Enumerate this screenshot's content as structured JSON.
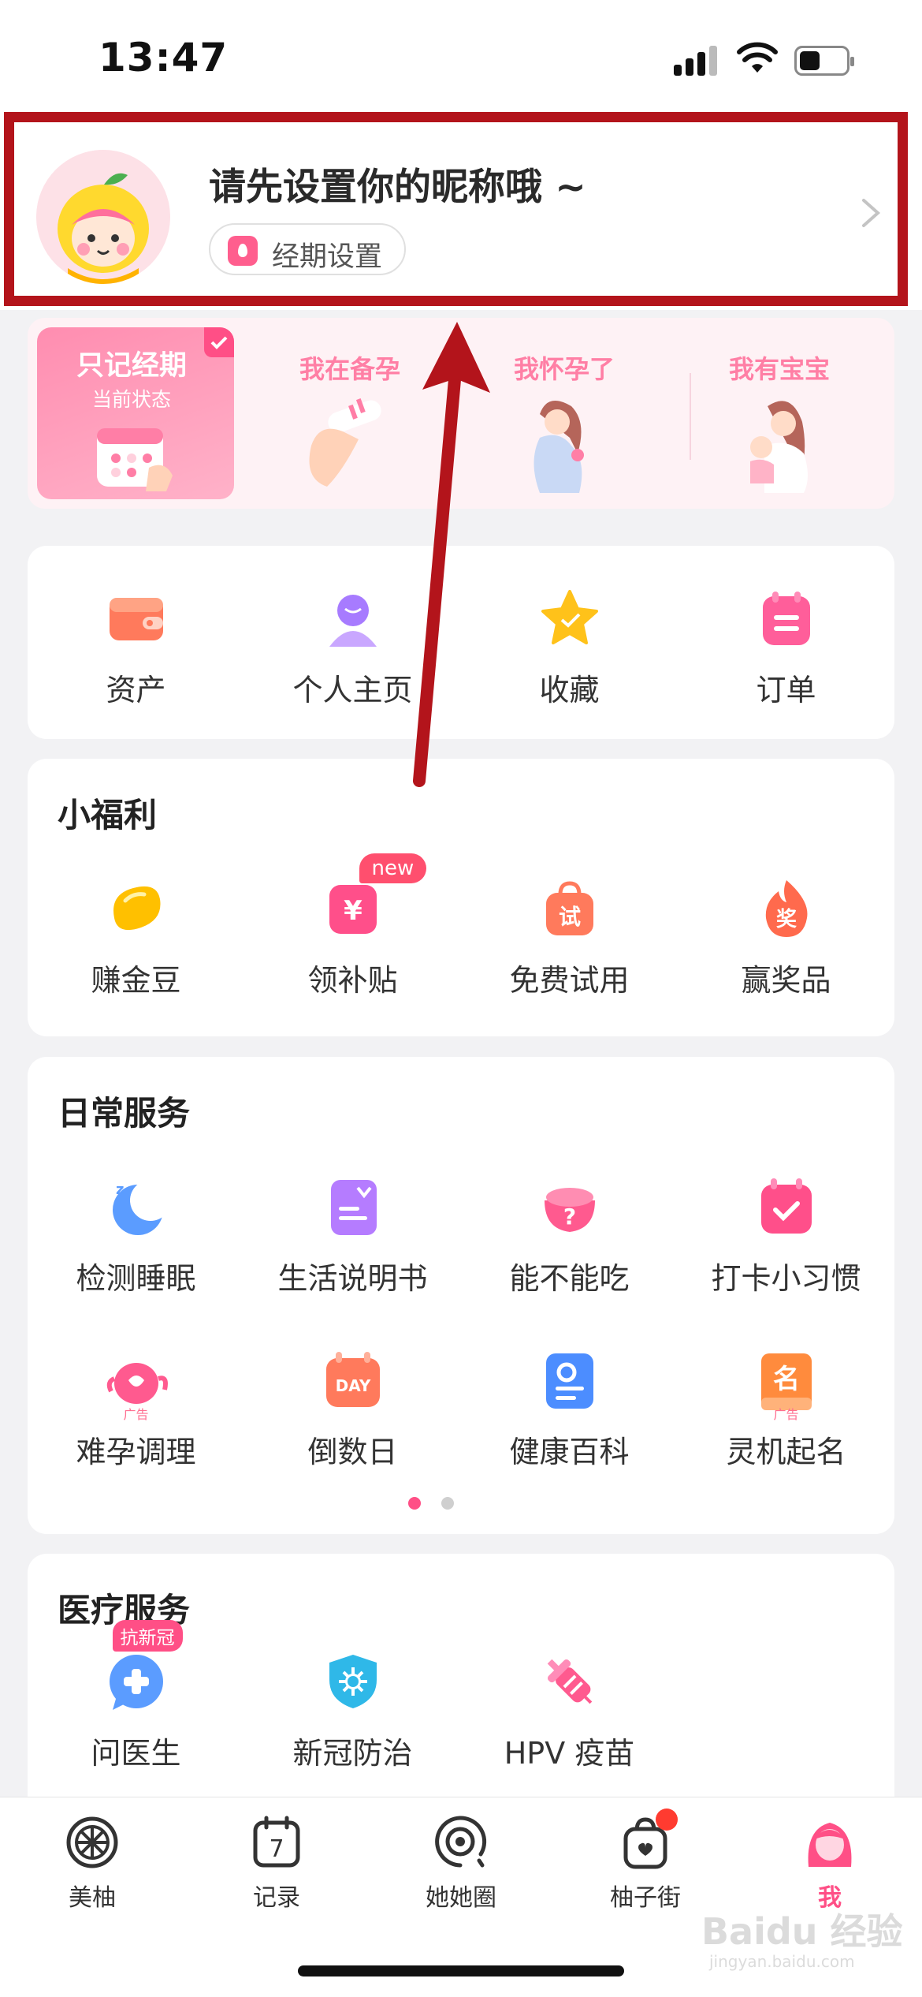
{
  "status": {
    "time": "13:47",
    "battery_level": 0.45
  },
  "profile": {
    "nickname": "请先设置你的昵称哦 ~",
    "period_label": "经期设置"
  },
  "states": {
    "active": {
      "title": "只记经期",
      "subtitle": "当前状态"
    },
    "items": [
      "我在备孕",
      "我怀孕了",
      "我有宝宝"
    ]
  },
  "quick": [
    {
      "label": "资产",
      "icon": "wallet-icon"
    },
    {
      "label": "个人主页",
      "icon": "person-icon"
    },
    {
      "label": "收藏",
      "icon": "star-icon"
    },
    {
      "label": "订单",
      "icon": "order-icon"
    }
  ],
  "welfare": {
    "title": "小福利",
    "items": [
      {
        "label": "赚金豆",
        "icon": "gold-bean-icon"
      },
      {
        "label": "领补贴",
        "icon": "subsidy-icon",
        "badge": "new"
      },
      {
        "label": "免费试用",
        "icon": "trial-bag-icon",
        "glyph": "试"
      },
      {
        "label": "赢奖品",
        "icon": "prize-flame-icon",
        "glyph": "奖"
      }
    ]
  },
  "daily": {
    "title": "日常服务",
    "items": [
      {
        "label": "检测睡眠",
        "icon": "sleep-moon-icon"
      },
      {
        "label": "生活说明书",
        "icon": "manual-book-icon"
      },
      {
        "label": "能不能吃",
        "icon": "food-bowl-icon"
      },
      {
        "label": "打卡小习惯",
        "icon": "checkin-calendar-icon"
      },
      {
        "label": "难孕调理",
        "icon": "teapot-icon",
        "ad": "广告"
      },
      {
        "label": "倒数日",
        "icon": "countdown-icon",
        "glyph": "DAY"
      },
      {
        "label": "健康百科",
        "icon": "health-wiki-icon"
      },
      {
        "label": "灵机起名",
        "icon": "naming-icon",
        "glyph": "名",
        "ad": "广告"
      }
    ]
  },
  "medical": {
    "title": "医疗服务",
    "items": [
      {
        "label": "问医生",
        "icon": "doctor-chat-icon",
        "badge": "抗新冠"
      },
      {
        "label": "新冠防治",
        "icon": "covid-shield-icon"
      },
      {
        "label": "HPV 疫苗",
        "icon": "vaccine-syringe-icon"
      }
    ]
  },
  "tabs": [
    {
      "label": "美柚",
      "icon": "pomelo-icon"
    },
    {
      "label": "记录",
      "icon": "calendar-7-icon",
      "glyph": "7"
    },
    {
      "label": "她她圈",
      "icon": "community-icon"
    },
    {
      "label": "柚子街",
      "icon": "shop-bag-icon"
    },
    {
      "label": "我",
      "icon": "me-avatar-icon",
      "active": true
    }
  ],
  "colors": {
    "accent": "#ff4f86",
    "highlight": "#b3141b"
  },
  "watermark": {
    "brand": "Baidu 经验",
    "url": "jingyan.baidu.com"
  }
}
